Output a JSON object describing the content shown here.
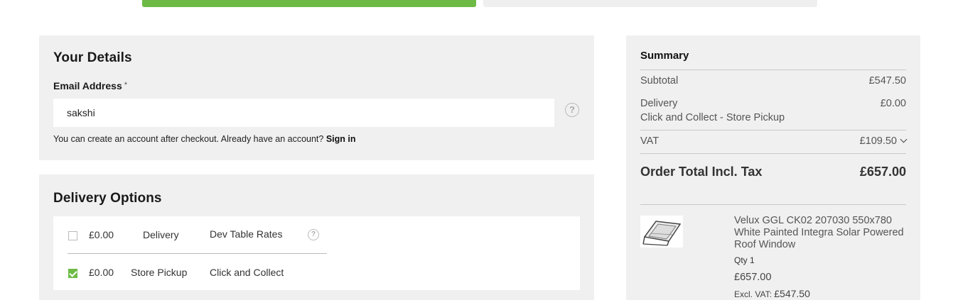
{
  "details": {
    "title": "Your Details",
    "email_label": "Email Address",
    "required_mark": "*",
    "email_value": "sakshi",
    "help_glyph": "?",
    "note_text": "You can create an account after checkout. Already have an account?",
    "sign_in": "Sign in"
  },
  "delivery": {
    "title": "Delivery Options",
    "options": [
      {
        "price": "£0.00",
        "method": "Delivery",
        "carrier": "Dev Table Rates",
        "checked": false
      },
      {
        "price": "£0.00",
        "method": "Store Pickup",
        "carrier": "Click and Collect",
        "checked": true
      }
    ]
  },
  "summary": {
    "title": "Summary",
    "subtotal_label": "Subtotal",
    "subtotal_value": "£547.50",
    "delivery_label": "Delivery",
    "delivery_value": "£0.00",
    "delivery_method": "Click and Collect - Store Pickup",
    "vat_label": "VAT",
    "vat_value": "£109.50",
    "total_label": "Order Total Incl. Tax",
    "total_value": "£657.00",
    "item": {
      "name": "Velux GGL CK02 207030 550x780 White Painted Integra Solar Powered Roof Window",
      "qty": "Qty 1",
      "price": "£657.00",
      "excl_label": "Excl. VAT:",
      "excl_value": "£547.50"
    }
  },
  "colors": {
    "accent": "#6dbb45",
    "panel": "#f0f0f0"
  }
}
